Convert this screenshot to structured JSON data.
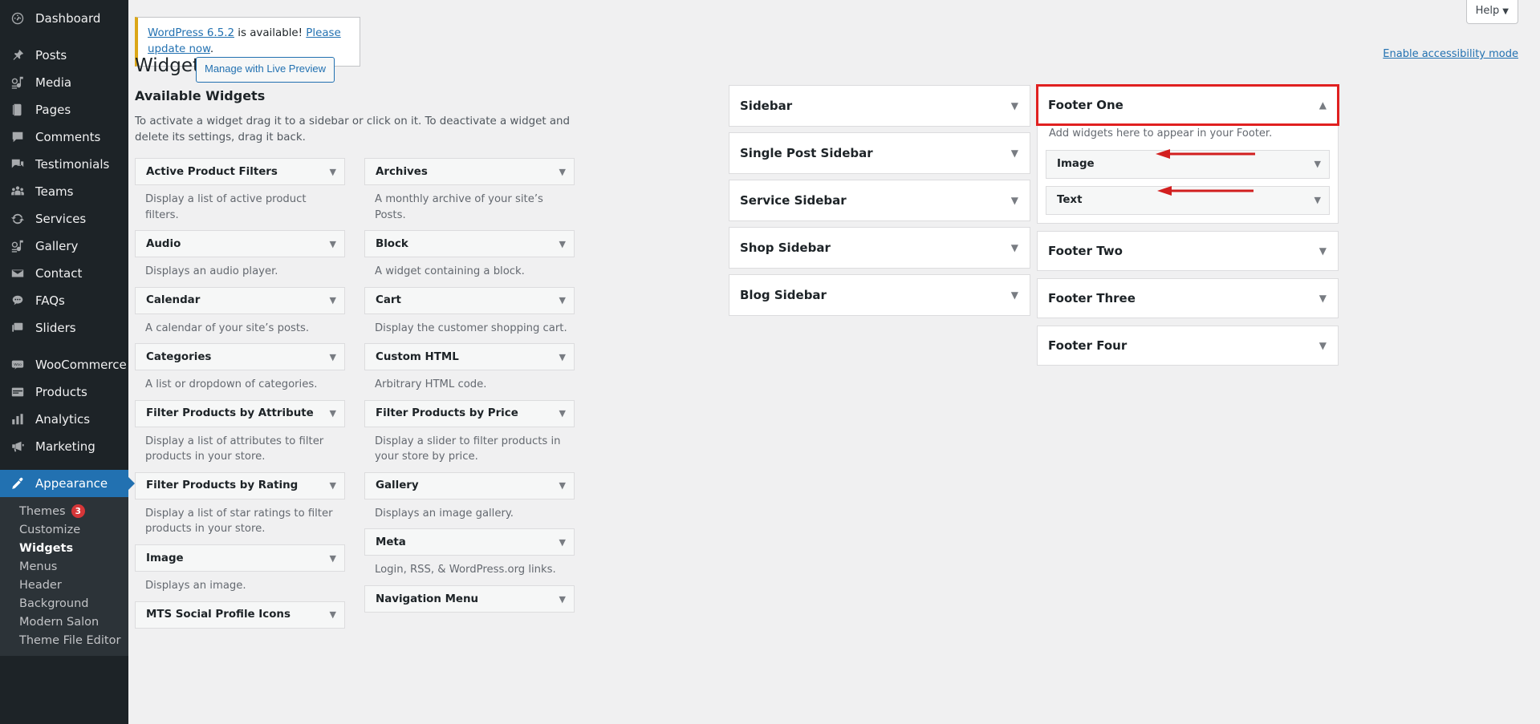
{
  "admin_menu": {
    "items": [
      {
        "label": "Dashboard",
        "icon": "dashboard-icon"
      },
      {
        "label": "Posts",
        "icon": "pin-icon"
      },
      {
        "label": "Media",
        "icon": "media-icon"
      },
      {
        "label": "Pages",
        "icon": "pages-icon"
      },
      {
        "label": "Comments",
        "icon": "comments-icon"
      },
      {
        "label": "Testimonials",
        "icon": "testimonials-icon"
      },
      {
        "label": "Teams",
        "icon": "teams-icon"
      },
      {
        "label": "Services",
        "icon": "services-icon"
      },
      {
        "label": "Gallery",
        "icon": "gallery-icon"
      },
      {
        "label": "Contact",
        "icon": "envelope-icon"
      },
      {
        "label": "FAQs",
        "icon": "faq-icon"
      },
      {
        "label": "Sliders",
        "icon": "sliders-icon"
      },
      {
        "label": "WooCommerce",
        "icon": "woocommerce-icon"
      },
      {
        "label": "Products",
        "icon": "products-icon"
      },
      {
        "label": "Analytics",
        "icon": "analytics-icon"
      },
      {
        "label": "Marketing",
        "icon": "marketing-icon"
      },
      {
        "label": "Appearance",
        "icon": "appearance-icon"
      }
    ],
    "appearance_submenu": [
      {
        "label": "Themes",
        "badge": "3"
      },
      {
        "label": "Customize",
        "badge": ""
      },
      {
        "label": "Widgets",
        "badge": ""
      },
      {
        "label": "Menus",
        "badge": ""
      },
      {
        "label": "Header",
        "badge": ""
      },
      {
        "label": "Background",
        "badge": ""
      },
      {
        "label": "Modern Salon",
        "badge": ""
      },
      {
        "label": "Theme File Editor",
        "badge": ""
      }
    ]
  },
  "header": {
    "help_label": "Help",
    "help_caret": "▼",
    "accessibility_link": "Enable accessibility mode"
  },
  "notice": {
    "link_version": "WordPress 6.5.2",
    "middle_text": " is available! ",
    "link_update": "Please update now",
    "trailing": "."
  },
  "page": {
    "title": "Widgets",
    "live_preview_label": "Manage with Live Preview"
  },
  "available_widgets": {
    "heading": "Available Widgets",
    "intro": "To activate a widget drag it to a sidebar or click on it. To deactivate a widget and delete its settings, drag it back.",
    "caret": "▼",
    "left_column": [
      {
        "title": "Active Product Filters",
        "desc": "Display a list of active product filters."
      },
      {
        "title": "Audio",
        "desc": "Displays an audio player."
      },
      {
        "title": "Calendar",
        "desc": "A calendar of your site’s posts."
      },
      {
        "title": "Categories",
        "desc": "A list or dropdown of categories."
      },
      {
        "title": "Filter Products by Attribute",
        "desc": "Display a list of attributes to filter products in your store."
      },
      {
        "title": "Filter Products by Rating",
        "desc": "Display a list of star ratings to filter products in your store."
      },
      {
        "title": "Image",
        "desc": "Displays an image."
      },
      {
        "title": "MTS Social Profile Icons",
        "desc": ""
      }
    ],
    "right_column": [
      {
        "title": "Archives",
        "desc": "A monthly archive of your site’s Posts."
      },
      {
        "title": "Block",
        "desc": "A widget containing a block."
      },
      {
        "title": "Cart",
        "desc": "Display the customer shopping cart."
      },
      {
        "title": "Custom HTML",
        "desc": "Arbitrary HTML code."
      },
      {
        "title": "Filter Products by Price",
        "desc": "Display a slider to filter products in your store by price."
      },
      {
        "title": "Gallery",
        "desc": "Displays an image gallery."
      },
      {
        "title": "Meta",
        "desc": "Login, RSS, & WordPress.org links."
      },
      {
        "title": "Navigation Menu",
        "desc": ""
      }
    ]
  },
  "middle_sidebars": [
    {
      "title": "Sidebar",
      "caret": "▼"
    },
    {
      "title": "Single Post Sidebar",
      "caret": "▼"
    },
    {
      "title": "Service Sidebar",
      "caret": "▼"
    },
    {
      "title": "Shop Sidebar",
      "caret": "▼"
    },
    {
      "title": "Blog Sidebar",
      "caret": "▼"
    }
  ],
  "right_sidebars": {
    "footer_one": {
      "title": "Footer One",
      "caret": "▲",
      "description": "Add widgets here to appear in your Footer.",
      "widgets": [
        {
          "title": "Image",
          "caret": "▼"
        },
        {
          "title": "Text",
          "caret": "▼"
        }
      ]
    },
    "collapsed": [
      {
        "title": "Footer Two",
        "caret": "▼"
      },
      {
        "title": "Footer Three",
        "caret": "▼"
      },
      {
        "title": "Footer Four",
        "caret": "▼"
      }
    ]
  },
  "annotations": {
    "highlight_color": "#e02020",
    "arrow_color": "#d21f1f",
    "arrow_count": 2
  }
}
